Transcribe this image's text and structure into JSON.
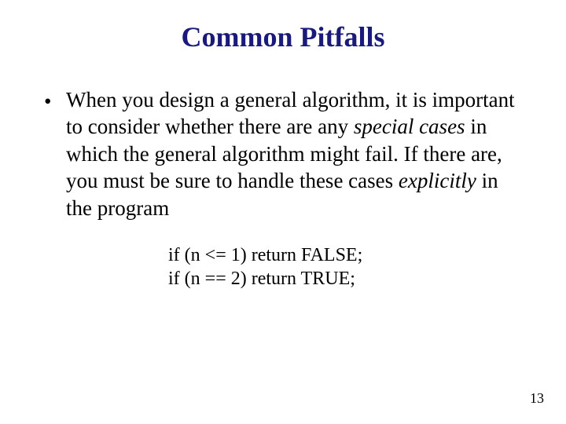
{
  "title": "Common Pitfalls",
  "bullet": {
    "pre": "When you design a general algorithm, it is important to consider whether there are any ",
    "italic1": "special cases",
    "mid": " in which the general algorithm might fail. If there are, you must be sure to handle these cases ",
    "italic2": "explicitly",
    "post": " in the program"
  },
  "code": {
    "line1": "if (n <= 1) return FALSE;",
    "line2": "if (n == 2) return TRUE;"
  },
  "page_number": "13"
}
